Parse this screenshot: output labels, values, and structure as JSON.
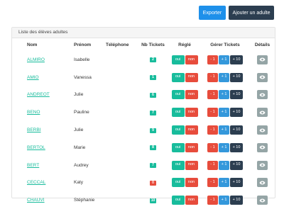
{
  "toolbar": {
    "export_label": "Exporter",
    "add_label": "Ajouter un adulte"
  },
  "panel": {
    "title": "Liste des élèves adultes"
  },
  "table": {
    "headers": {
      "nom": "Nom",
      "prenom": "Prénom",
      "telephone": "Téléphone",
      "nb_tickets": "Nb Tickets",
      "regle": "Réglé",
      "gerer": "Gérer Tickets",
      "details": "Détails"
    },
    "buttons": {
      "oui": "oui",
      "non": "non",
      "minus": "- 1",
      "plus": "+ 1",
      "plus10": "+ 10"
    },
    "rows": [
      {
        "nom": "ALMIRO",
        "prenom": "Isabelle",
        "telephone": "",
        "tickets": "2",
        "badge_color": "#18bc9c"
      },
      {
        "nom": "AMIO",
        "prenom": "Vanessa",
        "telephone": "",
        "tickets": "1",
        "badge_color": "#18bc9c"
      },
      {
        "nom": "ANDREOT",
        "prenom": "Julie",
        "telephone": "",
        "tickets": "6",
        "badge_color": "#18bc9c"
      },
      {
        "nom": "BENO",
        "prenom": "Pauline",
        "telephone": "",
        "tickets": "7",
        "badge_color": "#18bc9c"
      },
      {
        "nom": "BERBI",
        "prenom": "Julie",
        "telephone": "",
        "tickets": "9",
        "badge_color": "#18bc9c"
      },
      {
        "nom": "BERTOL",
        "prenom": "Marie",
        "telephone": "",
        "tickets": "8",
        "badge_color": "#18bc9c"
      },
      {
        "nom": "BERT",
        "prenom": "Audrey",
        "telephone": "",
        "tickets": "7",
        "badge_color": "#18bc9c"
      },
      {
        "nom": "CECCAL",
        "prenom": "Katy",
        "telephone": "",
        "tickets": "0",
        "badge_color": "#e74c3c"
      },
      {
        "nom": "CHAUVI",
        "prenom": "Stéphanie",
        "telephone": "",
        "tickets": "10",
        "badge_color": "#18bc9c"
      }
    ]
  },
  "colors": {
    "primary": "#1e90ea",
    "dark": "#2c3e50",
    "success": "#18bc9c",
    "danger": "#e74c3c",
    "info": "#3498db",
    "muted": "#95a5a6"
  },
  "icons": {
    "details": "eye-icon"
  }
}
